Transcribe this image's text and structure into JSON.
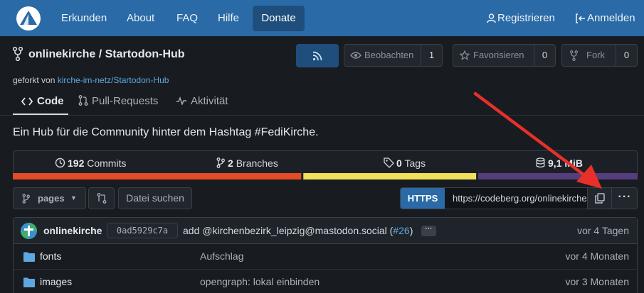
{
  "nav": {
    "links": [
      "Erkunden",
      "About",
      "FAQ",
      "Hilfe"
    ],
    "donate": "Donate",
    "register": "Registrieren",
    "login": "Anmelden"
  },
  "repo": {
    "title": "onlinekirche / Startodon-Hub",
    "forked_prefix": "geforkt von",
    "forked_from": "kirche-im-netz/Startodon-Hub",
    "watch_label": "Beobachten",
    "watch_count": "1",
    "star_label": "Favorisieren",
    "star_count": "0",
    "fork_label": "Fork",
    "fork_count": "0"
  },
  "tabs": [
    "Code",
    "Pull-Requests",
    "Aktivität"
  ],
  "description": "Ein Hub für die Community hinter dem Hashtag #FediKirche.",
  "stats": {
    "commits_num": "192",
    "commits_label": "Commits",
    "branches_num": "2",
    "branches_label": "Branches",
    "tags_num": "0",
    "tags_label": "Tags",
    "size": "9,1 MiB"
  },
  "languages": [
    {
      "color": "#e34c26",
      "fraction": 0.465
    },
    {
      "color": "#f1e05a",
      "fraction": 0.28
    },
    {
      "color": "#563d7c",
      "fraction": 0.255
    }
  ],
  "toolbar": {
    "branch": "pages",
    "find_file": "Datei suchen",
    "clone_protocol": "HTTPS",
    "clone_url": "https://codeberg.org/onlinekirche/Startodon-Hub.git",
    "more": "···"
  },
  "last_commit": {
    "author": "onlinekirche",
    "sha": "0ad5929c7a",
    "message": "add @kirchenbezirk_leipzig@mastodon.social (",
    "pr": "#26",
    "message_end": ")",
    "time": "vor 4 Tagen"
  },
  "files": [
    {
      "name": "fonts",
      "message": "Aufschlag",
      "time": "vor 4 Monaten"
    },
    {
      "name": "images",
      "message": "opengraph: lokal einbinden",
      "time": "vor 3 Monaten"
    }
  ]
}
